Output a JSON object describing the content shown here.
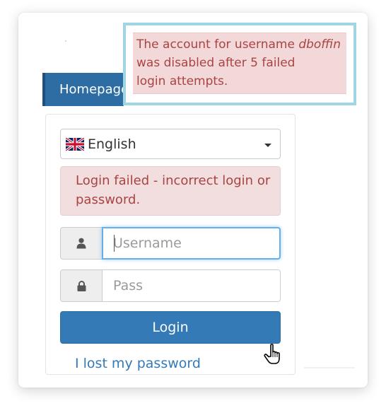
{
  "callout": {
    "message_prefix": "The account for username ",
    "username": "dboffin",
    "message_line2": "was disabled after 5 failed",
    "message_line3": "login attempts."
  },
  "nav": {
    "home_tab_label": "Homepage"
  },
  "language": {
    "selected": "English",
    "flag_icon": "uk-flag-icon"
  },
  "alert": {
    "text": "Login failed - incorrect login or password."
  },
  "form": {
    "username_placeholder": "Username",
    "password_placeholder": "Pass",
    "login_button": "Login",
    "lost_password_link": "I lost my password"
  },
  "icons": {
    "user": "user-icon",
    "lock": "lock-icon",
    "cursor": "hand-pointer-icon"
  },
  "colors": {
    "primary": "#337ab7",
    "alert_bg": "#f2dede",
    "alert_text": "#a94442",
    "callout_border": "#9fd6e6"
  }
}
